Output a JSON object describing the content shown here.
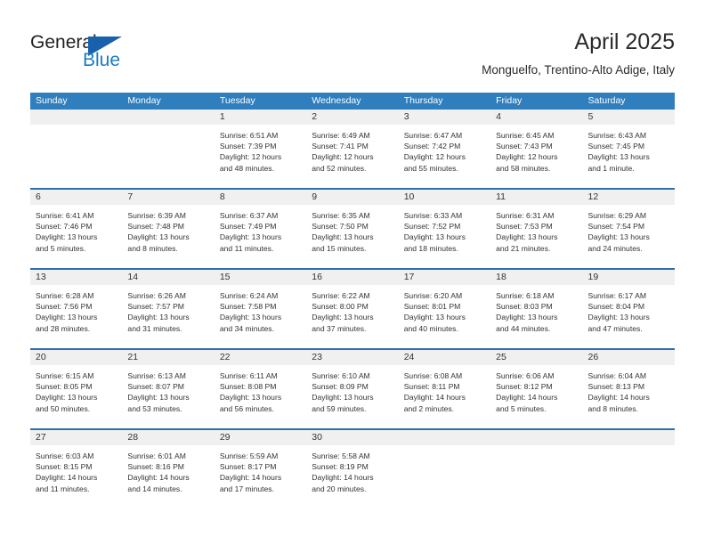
{
  "brand": {
    "name_part1": "General",
    "name_part2": "Blue",
    "triangle_icon": "triangle-icon",
    "color_dark": "#231f20",
    "color_blue": "#1a7bc4",
    "color_triangle": "#1862ad"
  },
  "header": {
    "title": "April 2025",
    "subtitle": "Monguelfo, Trentino-Alto Adige, Italy"
  },
  "theme": {
    "header_bar": "#2f7ebd",
    "week_divider": "#2f6ea8",
    "day_band": "#f0f0f0",
    "text": "#333333"
  },
  "weekdays": [
    "Sunday",
    "Monday",
    "Tuesday",
    "Wednesday",
    "Thursday",
    "Friday",
    "Saturday"
  ],
  "weeks": [
    [
      {
        "day": "",
        "info": ""
      },
      {
        "day": "",
        "info": ""
      },
      {
        "day": "1",
        "info": "Sunrise: 6:51 AM\nSunset: 7:39 PM\nDaylight: 12 hours\nand 48 minutes."
      },
      {
        "day": "2",
        "info": "Sunrise: 6:49 AM\nSunset: 7:41 PM\nDaylight: 12 hours\nand 52 minutes."
      },
      {
        "day": "3",
        "info": "Sunrise: 6:47 AM\nSunset: 7:42 PM\nDaylight: 12 hours\nand 55 minutes."
      },
      {
        "day": "4",
        "info": "Sunrise: 6:45 AM\nSunset: 7:43 PM\nDaylight: 12 hours\nand 58 minutes."
      },
      {
        "day": "5",
        "info": "Sunrise: 6:43 AM\nSunset: 7:45 PM\nDaylight: 13 hours\nand 1 minute."
      }
    ],
    [
      {
        "day": "6",
        "info": "Sunrise: 6:41 AM\nSunset: 7:46 PM\nDaylight: 13 hours\nand 5 minutes."
      },
      {
        "day": "7",
        "info": "Sunrise: 6:39 AM\nSunset: 7:48 PM\nDaylight: 13 hours\nand 8 minutes."
      },
      {
        "day": "8",
        "info": "Sunrise: 6:37 AM\nSunset: 7:49 PM\nDaylight: 13 hours\nand 11 minutes."
      },
      {
        "day": "9",
        "info": "Sunrise: 6:35 AM\nSunset: 7:50 PM\nDaylight: 13 hours\nand 15 minutes."
      },
      {
        "day": "10",
        "info": "Sunrise: 6:33 AM\nSunset: 7:52 PM\nDaylight: 13 hours\nand 18 minutes."
      },
      {
        "day": "11",
        "info": "Sunrise: 6:31 AM\nSunset: 7:53 PM\nDaylight: 13 hours\nand 21 minutes."
      },
      {
        "day": "12",
        "info": "Sunrise: 6:29 AM\nSunset: 7:54 PM\nDaylight: 13 hours\nand 24 minutes."
      }
    ],
    [
      {
        "day": "13",
        "info": "Sunrise: 6:28 AM\nSunset: 7:56 PM\nDaylight: 13 hours\nand 28 minutes."
      },
      {
        "day": "14",
        "info": "Sunrise: 6:26 AM\nSunset: 7:57 PM\nDaylight: 13 hours\nand 31 minutes."
      },
      {
        "day": "15",
        "info": "Sunrise: 6:24 AM\nSunset: 7:58 PM\nDaylight: 13 hours\nand 34 minutes."
      },
      {
        "day": "16",
        "info": "Sunrise: 6:22 AM\nSunset: 8:00 PM\nDaylight: 13 hours\nand 37 minutes."
      },
      {
        "day": "17",
        "info": "Sunrise: 6:20 AM\nSunset: 8:01 PM\nDaylight: 13 hours\nand 40 minutes."
      },
      {
        "day": "18",
        "info": "Sunrise: 6:18 AM\nSunset: 8:03 PM\nDaylight: 13 hours\nand 44 minutes."
      },
      {
        "day": "19",
        "info": "Sunrise: 6:17 AM\nSunset: 8:04 PM\nDaylight: 13 hours\nand 47 minutes."
      }
    ],
    [
      {
        "day": "20",
        "info": "Sunrise: 6:15 AM\nSunset: 8:05 PM\nDaylight: 13 hours\nand 50 minutes."
      },
      {
        "day": "21",
        "info": "Sunrise: 6:13 AM\nSunset: 8:07 PM\nDaylight: 13 hours\nand 53 minutes."
      },
      {
        "day": "22",
        "info": "Sunrise: 6:11 AM\nSunset: 8:08 PM\nDaylight: 13 hours\nand 56 minutes."
      },
      {
        "day": "23",
        "info": "Sunrise: 6:10 AM\nSunset: 8:09 PM\nDaylight: 13 hours\nand 59 minutes."
      },
      {
        "day": "24",
        "info": "Sunrise: 6:08 AM\nSunset: 8:11 PM\nDaylight: 14 hours\nand 2 minutes."
      },
      {
        "day": "25",
        "info": "Sunrise: 6:06 AM\nSunset: 8:12 PM\nDaylight: 14 hours\nand 5 minutes."
      },
      {
        "day": "26",
        "info": "Sunrise: 6:04 AM\nSunset: 8:13 PM\nDaylight: 14 hours\nand 8 minutes."
      }
    ],
    [
      {
        "day": "27",
        "info": "Sunrise: 6:03 AM\nSunset: 8:15 PM\nDaylight: 14 hours\nand 11 minutes."
      },
      {
        "day": "28",
        "info": "Sunrise: 6:01 AM\nSunset: 8:16 PM\nDaylight: 14 hours\nand 14 minutes."
      },
      {
        "day": "29",
        "info": "Sunrise: 5:59 AM\nSunset: 8:17 PM\nDaylight: 14 hours\nand 17 minutes."
      },
      {
        "day": "30",
        "info": "Sunrise: 5:58 AM\nSunset: 8:19 PM\nDaylight: 14 hours\nand 20 minutes."
      },
      {
        "day": "",
        "info": ""
      },
      {
        "day": "",
        "info": ""
      },
      {
        "day": "",
        "info": ""
      }
    ]
  ]
}
